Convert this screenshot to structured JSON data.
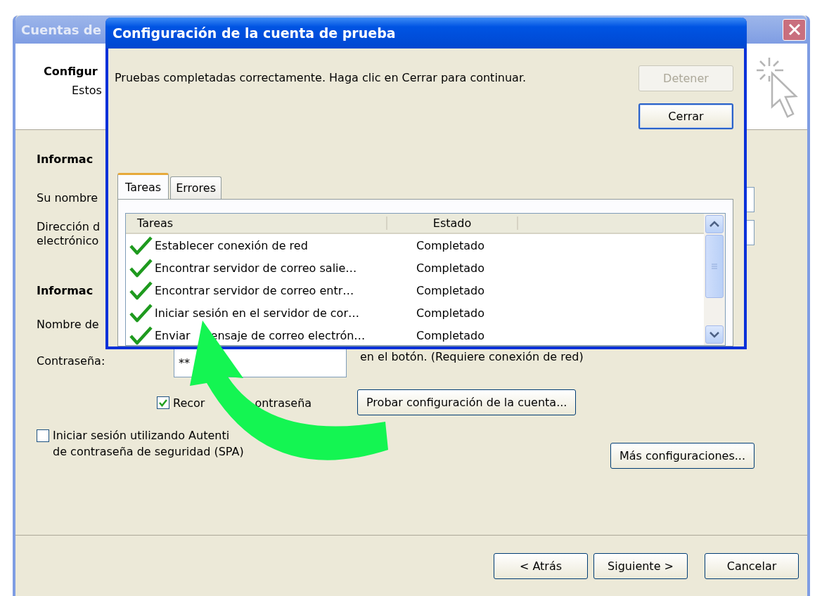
{
  "background_window": {
    "title": "Cuentas de",
    "header_title": "Configur",
    "header_subtitle": "Estos",
    "form": {
      "section_1": "Informac",
      "name_label": "Su nombre",
      "email_label": "Dirección d\nelectrónico",
      "section_2": "Informac",
      "user_label": "Nombre de",
      "password_label": "Contraseña:",
      "password_value": "**",
      "remember_password": {
        "label": "Recor",
        "label_after_arrow": "ontraseña",
        "checked": true
      },
      "test_note": "en el botón. (Requiere conexión de red)",
      "test_button": "Probar configuración de la cuenta...",
      "spa": {
        "label": "Iniciar sesión utilizando Autenti",
        "label_line_2": "de contraseña de seguridad (SPA)",
        "checked": false
      },
      "more_button": "Más configuraciones..."
    },
    "nav_buttons": [
      "< Atrás",
      "Siguiente >",
      "Cancelar"
    ]
  },
  "test_dialog": {
    "title": "Configuración de la cuenta de prueba",
    "message": "Pruebas completadas correctamente. Haga clic en Cerrar para continuar.",
    "buttons": [
      {
        "label": "Detener",
        "disabled": true,
        "default": false
      },
      {
        "label": "Cerrar",
        "disabled": false,
        "default": true
      }
    ],
    "tabs": [
      {
        "label": "Tareas",
        "selected": true
      },
      {
        "label": "Errores",
        "selected": false
      }
    ],
    "columns": [
      "Tareas",
      "Estado"
    ],
    "rows": [
      {
        "task": "Establecer conexión de red",
        "status": "Completado",
        "done": true
      },
      {
        "task": "Encontrar servidor de correo salie…",
        "status": "Completado",
        "done": true
      },
      {
        "task": "Encontrar servidor de correo entr…",
        "status": "Completado",
        "done": true
      },
      {
        "task": "Iniciar sesión en el servidor de cor…",
        "status": "Completado",
        "done": true
      },
      {
        "task": "Enviar",
        "task_after_arrow": "ensaje de correo electrón…",
        "status": "Completado",
        "done": true
      }
    ]
  }
}
